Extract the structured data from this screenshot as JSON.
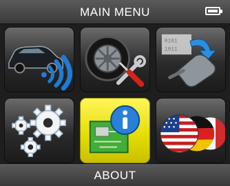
{
  "header": {
    "title": "MAIN MENU",
    "battery_level": 0.85
  },
  "menu": {
    "items": [
      {
        "id": "sensor-activation",
        "icon": "car-sensor-signal-icon"
      },
      {
        "id": "service-tools",
        "icon": "tire-tools-icon"
      },
      {
        "id": "programming",
        "icon": "sensor-programming-icon"
      },
      {
        "id": "settings",
        "icon": "gears-icon"
      },
      {
        "id": "about",
        "icon": "info-circuit-icon"
      },
      {
        "id": "language",
        "icon": "flags-icon"
      }
    ],
    "selected_index": 4
  },
  "footer": {
    "label": "ABOUT"
  },
  "colors": {
    "selected_tile": "#e8e000",
    "tile_dark": "#2b2b2b",
    "accent_blue": "#1f7bd6"
  }
}
